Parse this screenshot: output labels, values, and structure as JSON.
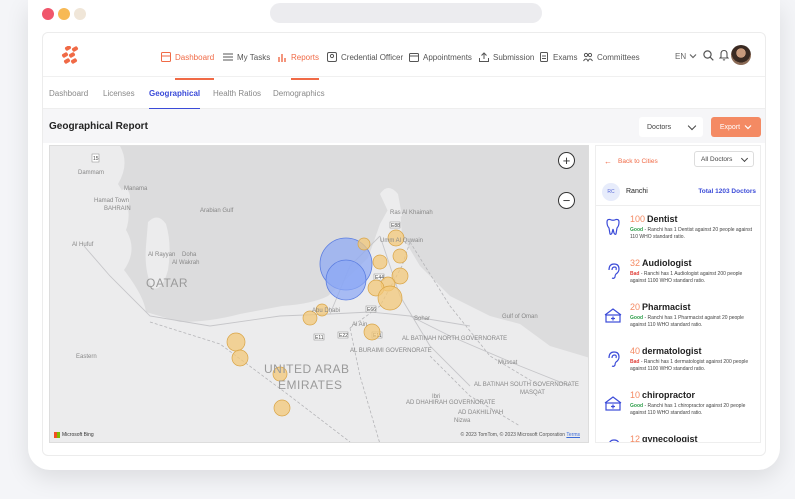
{
  "nav": {
    "items": [
      {
        "label": "Dashboard",
        "icon": "dashboard-icon"
      },
      {
        "label": "My Tasks",
        "icon": "tasks-icon"
      },
      {
        "label": "Reports",
        "icon": "reports-icon"
      },
      {
        "label": "Credential Officer",
        "icon": "credential-icon"
      },
      {
        "label": "Appointments",
        "icon": "appointments-icon"
      },
      {
        "label": "Submission",
        "icon": "submission-icon"
      },
      {
        "label": "Exams",
        "icon": "exams-icon"
      },
      {
        "label": "Committees",
        "icon": "committees-icon"
      }
    ],
    "language": "EN",
    "accent": "#f06a46"
  },
  "subtabs": [
    "Dashboard",
    "Licenses",
    "Geographical",
    "Health Ratios",
    "Demographics"
  ],
  "header": {
    "title": "Geographical Report",
    "select_value": "Doctors",
    "export_label": "Export"
  },
  "map": {
    "labels": {
      "dammam": "Dammam",
      "manama": "Manama",
      "hamad": "Hamad Town",
      "bahrain": "BAHRAIN",
      "gulf": "Arabian Gulf",
      "hufuf": "Al Hufuf",
      "rayyan": "Al Rayyan",
      "doha": "Doha",
      "wakrah": "Al Wakrah",
      "qatar": "QATAR",
      "abudhabi": "Abu Dhabi",
      "alain": "Al Ain",
      "sohar": "Sohar",
      "gulfoman": "Gulf of Oman",
      "uae1": "UNITED ARAB",
      "uae2": "EMIRATES",
      "muscat": "Muscat",
      "ibri": "Ibri",
      "nizwa": "Nizwa",
      "eastern": "Eastern",
      "rasalk": "Ras Al Khaimah",
      "umm": "Umm Al Quwain",
      "batinah": "AL BATINAH NORTH GOVERNORATE",
      "buraimi": "AL BURAIMI GOVERNORATE",
      "dhahirah": "AD DHAHIRAH GOVERNORATE",
      "batinahs": "AL BATINAH SOUTH GOVERNORATE",
      "masqat": "MASQAT",
      "dakhiliyah": "AD DAKHILIYAH"
    },
    "road_shields": [
      "15",
      "E11",
      "E22",
      "E44",
      "E66",
      "E88",
      "E11"
    ],
    "zoom_in": "+",
    "zoom_out": "−",
    "attribution": "© 2023 TomTom, © 2023 Microsoft Corporation",
    "terms": "Terms",
    "bing": "Microsoft Bing"
  },
  "panel": {
    "back_label": "Back to Cities",
    "doctor_select": "All Doctors",
    "city_badge": "RC",
    "city_name": "Ranchi",
    "city_total": "Total 1203 Doctors",
    "ratios": [
      {
        "count": "100",
        "title": "Dentist",
        "status": "Good",
        "desc": " - Ranchi has 1 Dentist against 20 people against 110 WHO standard ratio.",
        "icon": "tooth-icon"
      },
      {
        "count": "32",
        "title": "Audiologist",
        "status": "Bad",
        "desc": " - Ranchi has 1 Audiologist against 200 people against 1100 WHO standard ratio.",
        "icon": "ear-icon"
      },
      {
        "count": "20",
        "title": "Pharmacist",
        "status": "Good",
        "desc": " - Ranchi has 1 Pharmacist against 20 people against 110 WHO standard ratio.",
        "icon": "pharmacy-icon"
      },
      {
        "count": "40",
        "title": "dermatologist",
        "status": "Bad",
        "desc": " - Ranchi has 1 dermatologist against 200 people against 1100 WHO standard ratio.",
        "icon": "ear-icon"
      },
      {
        "count": "10",
        "title": "chiropractor",
        "status": "Good",
        "desc": " - Ranchi has 1 chiropractor against 20 people against 110 WHO standard ratio.",
        "icon": "pharmacy-icon"
      },
      {
        "count": "12",
        "title": "gynecologist",
        "status": "",
        "desc": "",
        "icon": "ear-icon"
      }
    ]
  }
}
